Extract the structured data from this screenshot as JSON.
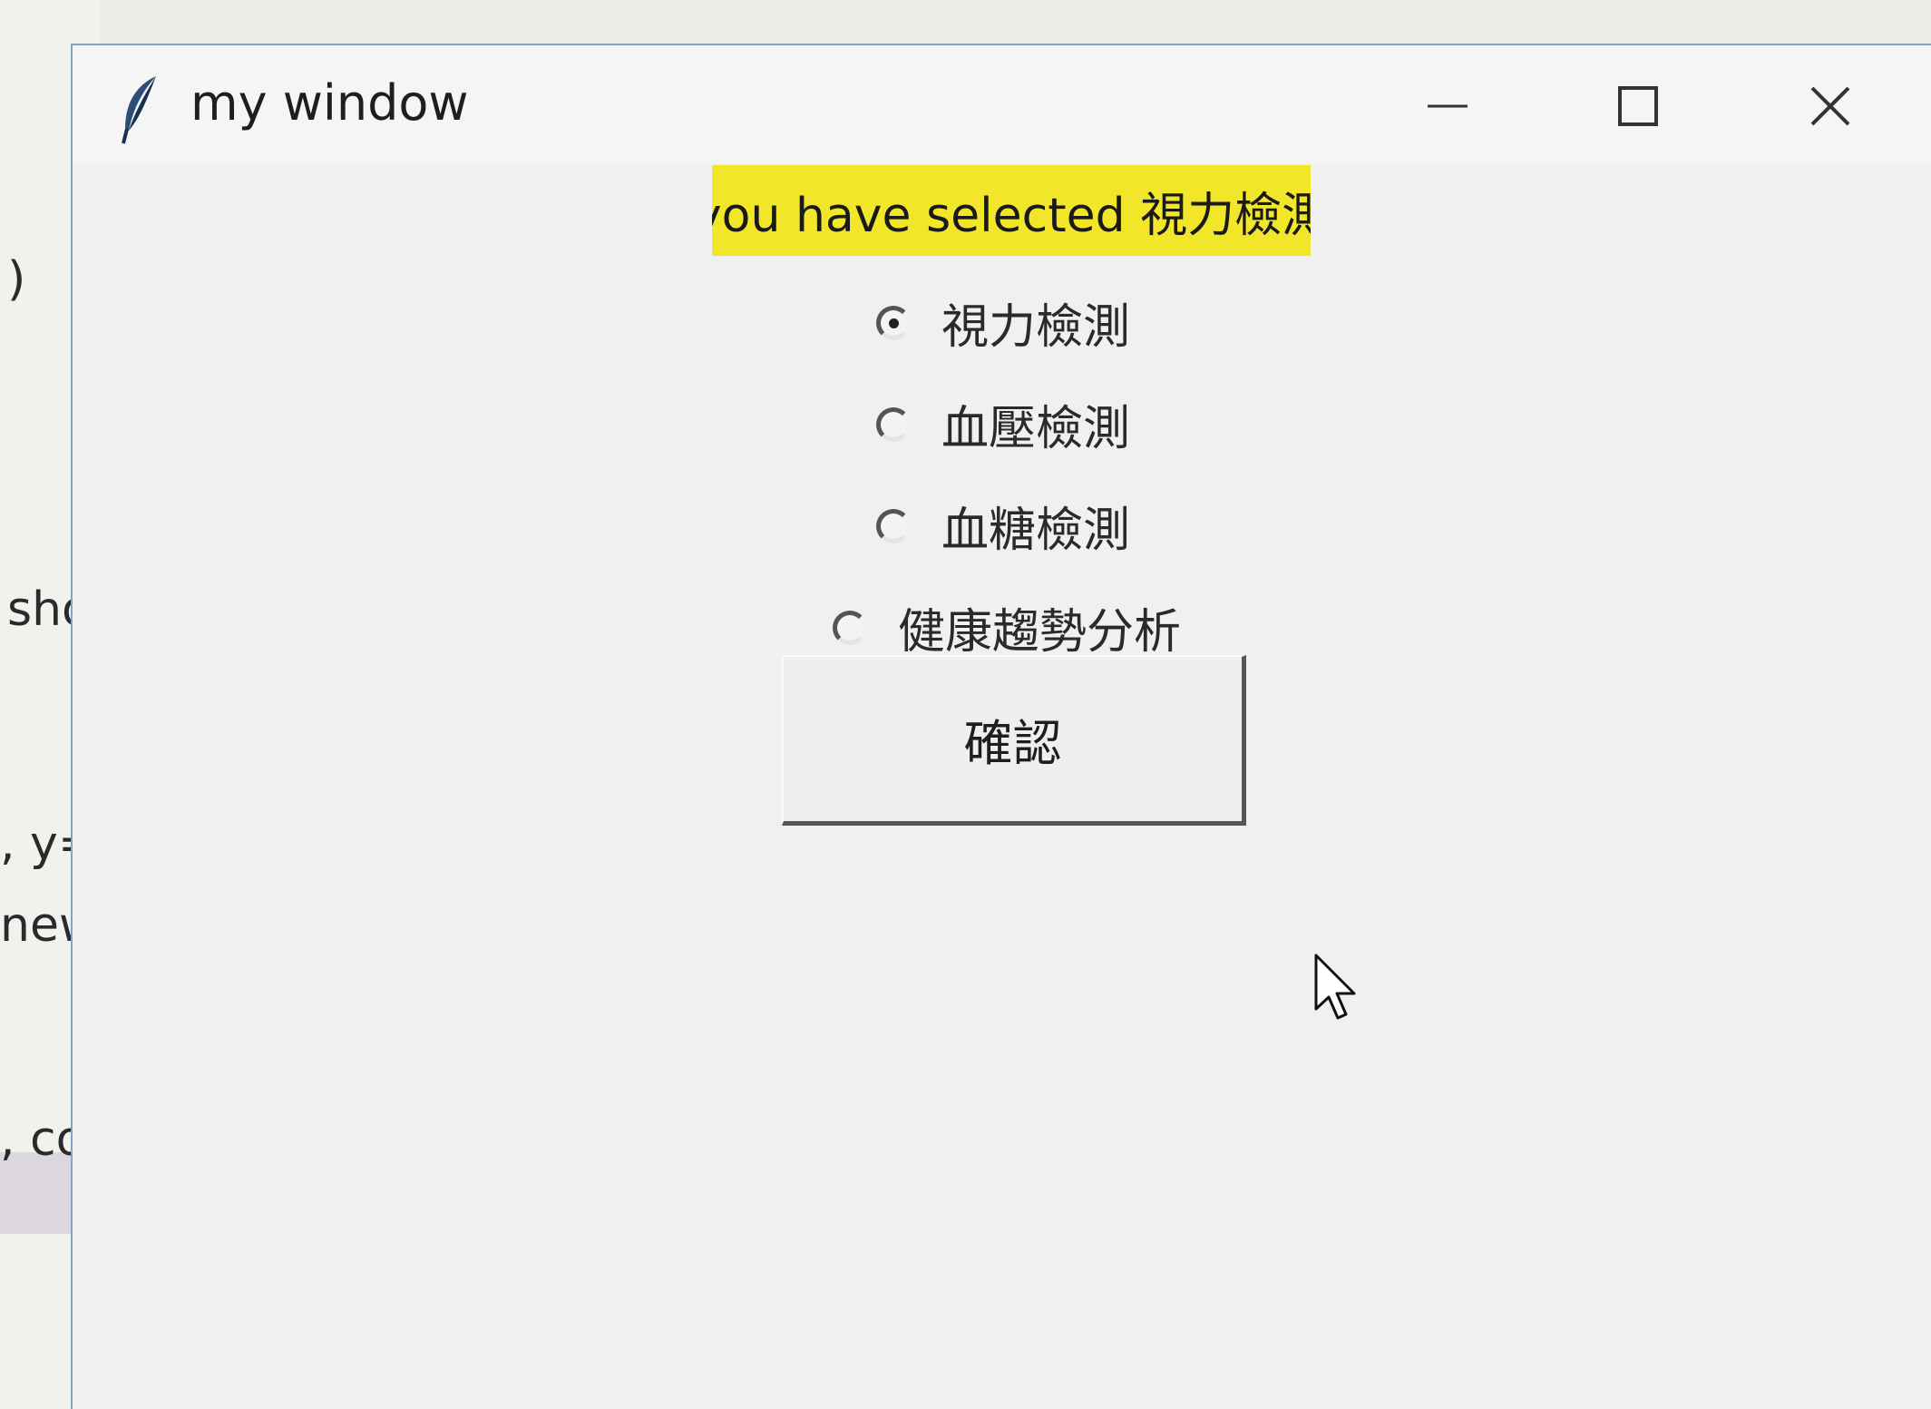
{
  "background_editor": {
    "fragments": [
      ")",
      "sho",
      ", y=",
      "new_",
      ", co"
    ]
  },
  "window": {
    "title": "my window",
    "controls": {
      "minimize_icon": "minimize-icon",
      "maximize_icon": "maximize-icon",
      "close_icon": "close-icon"
    }
  },
  "status_label": {
    "text": "you have selected 視力檢測",
    "background_color": "#f1e62a"
  },
  "radio_group": {
    "options": [
      {
        "label": "視力檢測",
        "checked": true
      },
      {
        "label": "血壓檢測",
        "checked": false
      },
      {
        "label": "血糖檢測",
        "checked": false
      },
      {
        "label": "健康趨勢分析",
        "checked": false
      }
    ]
  },
  "confirm_button": {
    "label": "確認"
  }
}
